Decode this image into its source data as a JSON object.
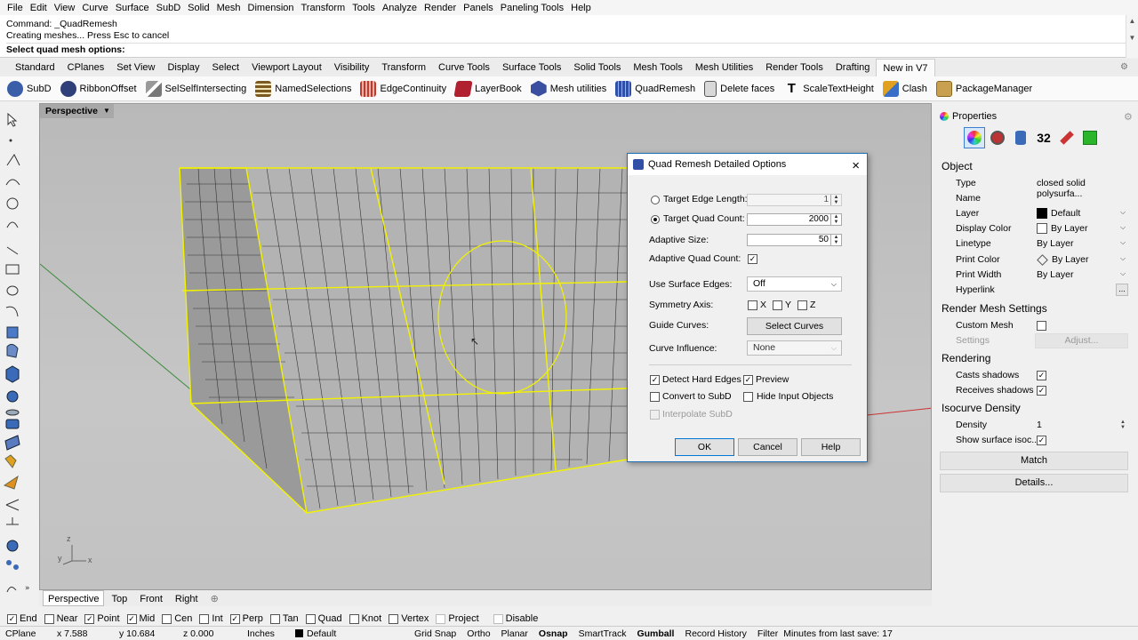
{
  "menu": [
    "File",
    "Edit",
    "View",
    "Curve",
    "Surface",
    "SubD",
    "Solid",
    "Mesh",
    "Dimension",
    "Transform",
    "Tools",
    "Analyze",
    "Render",
    "Panels",
    "Paneling Tools",
    "Help"
  ],
  "command": {
    "line1": "Command: _QuadRemesh",
    "line2": "Creating meshes... Press Esc to cancel",
    "prompt": "Select quad mesh options:"
  },
  "tabs": [
    "Standard",
    "CPlanes",
    "Set View",
    "Display",
    "Select",
    "Viewport Layout",
    "Visibility",
    "Transform",
    "Curve Tools",
    "Surface Tools",
    "Solid Tools",
    "Mesh Tools",
    "Mesh Utilities",
    "Render Tools",
    "Drafting",
    "New in V7"
  ],
  "toolbar": [
    {
      "label": "SubD",
      "color": "#3a5fa8"
    },
    {
      "label": "RibbonOffset",
      "color": "#2f3f79"
    },
    {
      "label": "SelSelfIntersecting",
      "color": "#777777"
    },
    {
      "label": "NamedSelections",
      "color": "#7a5a20"
    },
    {
      "label": "EdgeContinuity",
      "color": "#c0392b"
    },
    {
      "label": "LayerBook",
      "color": "#b0202f"
    },
    {
      "label": "Mesh utilities",
      "color": "#3a4fa0"
    },
    {
      "label": "QuadRemesh",
      "color": "#3050a8"
    },
    {
      "label": "Delete faces",
      "color": "#555555"
    },
    {
      "label": "ScaleTextHeight",
      "color": "#333333"
    },
    {
      "label": "Clash",
      "color": "#e0a020"
    },
    {
      "label": "PackageManager",
      "color": "#b89040"
    }
  ],
  "viewport": {
    "name": "Perspective",
    "axis_x": "x",
    "axis_y": "y",
    "axis_z": "z"
  },
  "viewport_tabs": [
    "Perspective",
    "Top",
    "Front",
    "Right"
  ],
  "dialog": {
    "title": "Quad Remesh Detailed Options",
    "target_edge_length_label": "Target Edge Length:",
    "target_edge_length": "1",
    "target_quad_count_label": "Target Quad Count:",
    "target_quad_count": "2000",
    "adaptive_size_label": "Adaptive Size:",
    "adaptive_size": "50",
    "adaptive_quad_count_label": "Adaptive Quad Count:",
    "use_surface_edges_label": "Use Surface Edges:",
    "use_surface_edges": "Off",
    "symmetry_axis_label": "Symmetry Axis:",
    "sym_x": "X",
    "sym_y": "Y",
    "sym_z": "Z",
    "guide_curves_label": "Guide Curves:",
    "select_curves": "Select Curves",
    "curve_influence_label": "Curve Influence:",
    "curve_influence": "None",
    "detect_hard_edges": "Detect Hard Edges",
    "preview": "Preview",
    "convert_to_subd": "Convert to SubD",
    "hide_input_objects": "Hide Input Objects",
    "interpolate_subd": "Interpolate SubD",
    "ok": "OK",
    "cancel": "Cancel",
    "help": "Help"
  },
  "properties": {
    "title": "Properties",
    "icon_label": "32",
    "object_section": "Object",
    "type_label": "Type",
    "type_value": "closed solid polysurfa...",
    "name_label": "Name",
    "layer_label": "Layer",
    "layer_value": "Default",
    "display_color_label": "Display Color",
    "display_color_value": "By Layer",
    "linetype_label": "Linetype",
    "linetype_value": "By Layer",
    "print_color_label": "Print Color",
    "print_color_value": "By Layer",
    "print_width_label": "Print Width",
    "print_width_value": "By Layer",
    "hyperlink_label": "Hyperlink",
    "hyperlink_btn": "...",
    "render_mesh_section": "Render Mesh Settings",
    "custom_mesh_label": "Custom Mesh",
    "settings_label": "Settings",
    "adjust_btn": "Adjust...",
    "rendering_section": "Rendering",
    "casts_shadows_label": "Casts shadows",
    "receives_shadows_label": "Receives shadows",
    "isocurve_section": "Isocurve Density",
    "density_label": "Density",
    "density_value": "1",
    "show_surface_label": "Show surface isoc...",
    "match_btn": "Match",
    "details_btn": "Details..."
  },
  "osnap": [
    {
      "label": "End",
      "checked": true
    },
    {
      "label": "Near",
      "checked": false
    },
    {
      "label": "Point",
      "checked": true
    },
    {
      "label": "Mid",
      "checked": true
    },
    {
      "label": "Cen",
      "checked": false
    },
    {
      "label": "Int",
      "checked": false
    },
    {
      "label": "Perp",
      "checked": true
    },
    {
      "label": "Tan",
      "checked": false
    },
    {
      "label": "Quad",
      "checked": false
    },
    {
      "label": "Knot",
      "checked": false
    },
    {
      "label": "Vertex",
      "checked": false
    },
    {
      "label": "Project",
      "checked": false,
      "disabled": true
    },
    {
      "label": "Disable",
      "checked": false,
      "disabled": true
    }
  ],
  "status": {
    "cplane": "CPlane",
    "x": "x 7.588",
    "y": "y 10.684",
    "z": "z 0.000",
    "units": "Inches",
    "layer": "Default",
    "grid_snap": "Grid Snap",
    "ortho": "Ortho",
    "planar": "Planar",
    "osnap": "Osnap",
    "smarttrack": "SmartTrack",
    "gumball": "Gumball",
    "record_history": "Record History",
    "filter": "Filter",
    "save_msg": "Minutes from last save: 17"
  }
}
